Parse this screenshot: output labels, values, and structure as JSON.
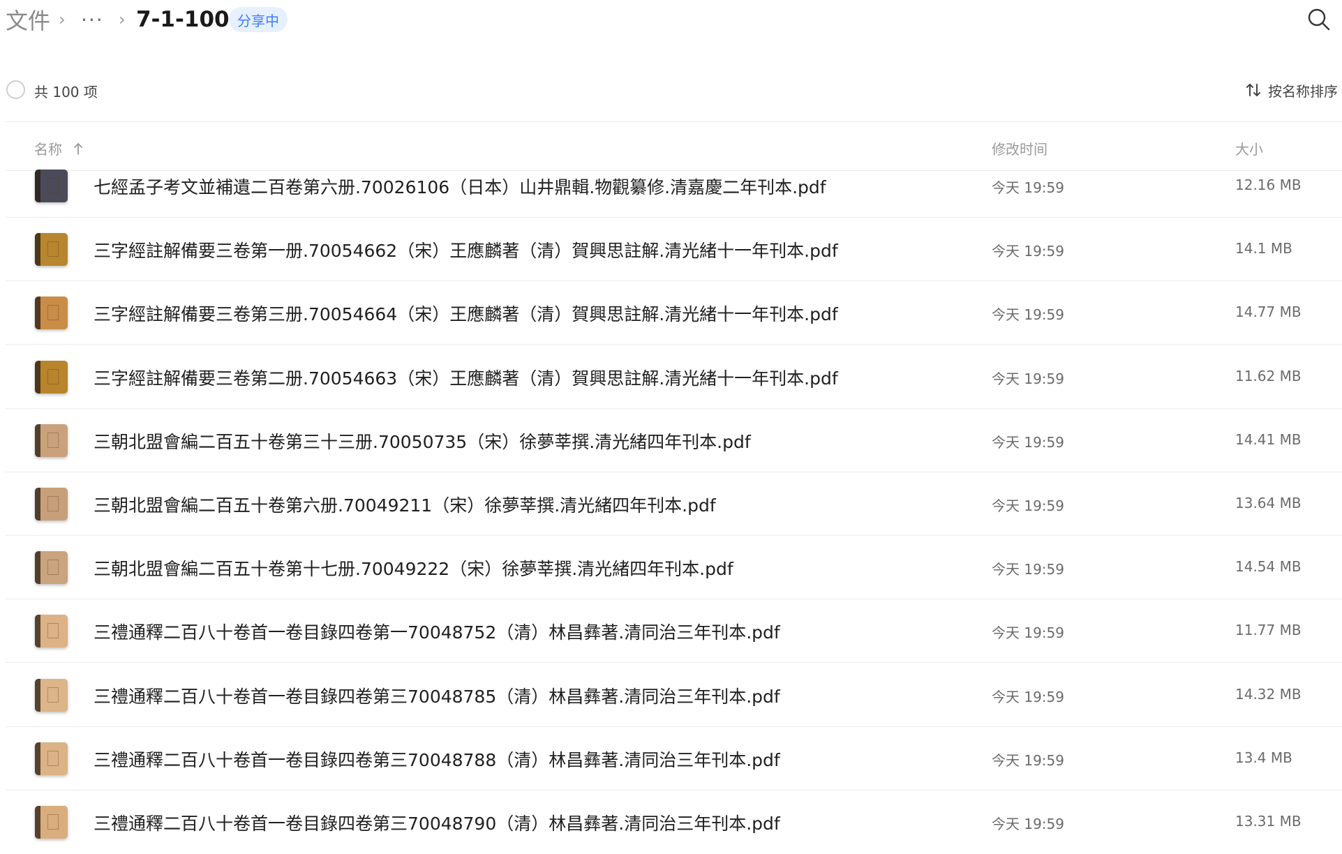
{
  "breadcrumb": {
    "root": "文件",
    "separator": "›",
    "ellipsis": "···",
    "current": "7-1-100",
    "badge": "分享中"
  },
  "toolbar": {
    "item_count": "共 100 项",
    "sort_label": "按名称排序"
  },
  "columns": {
    "name": "名称",
    "modified": "修改时间",
    "size": "大小"
  },
  "colors": {
    "badge_bg": "#e6f0ff",
    "badge_text": "#3d7bff"
  },
  "files": [
    {
      "name": "七經孟子考文並補遺二百卷第六册.70026106（日本）山井鼎輯.物觀纂修.清嘉慶二年刊本.pdf",
      "modified": "今天 19:59",
      "size": "12.16 MB",
      "thumb_color": "#4a4a58"
    },
    {
      "name": "三字經註解備要三卷第一册.70054662（宋）王應麟著（清）賀興思註解.清光緒十一年刊本.pdf",
      "modified": "今天 19:59",
      "size": "14.1 MB",
      "thumb_color": "#b8862e"
    },
    {
      "name": "三字經註解備要三卷第三册.70054664（宋）王應麟著（清）賀興思註解.清光緒十一年刊本.pdf",
      "modified": "今天 19:59",
      "size": "14.77 MB",
      "thumb_color": "#c98d47"
    },
    {
      "name": "三字經註解備要三卷第二册.70054663（宋）王應麟著（清）賀興思註解.清光緒十一年刊本.pdf",
      "modified": "今天 19:59",
      "size": "11.62 MB",
      "thumb_color": "#b8842c"
    },
    {
      "name": "三朝北盟會編二百五十卷第三十三册.70050735（宋）徐夢莘撰.清光緒四年刊本.pdf",
      "modified": "今天 19:59",
      "size": "14.41 MB",
      "thumb_color": "#c9a27c"
    },
    {
      "name": "三朝北盟會編二百五十卷第六册.70049211（宋）徐夢莘撰.清光緒四年刊本.pdf",
      "modified": "今天 19:59",
      "size": "13.64 MB",
      "thumb_color": "#c7a07a"
    },
    {
      "name": "三朝北盟會編二百五十卷第十七册.70049222（宋）徐夢莘撰.清光緒四年刊本.pdf",
      "modified": "今天 19:59",
      "size": "14.54 MB",
      "thumb_color": "#c9a47e"
    },
    {
      "name": "三禮通釋二百八十卷首一卷目錄四卷第一70048752（清）林昌彝著.清同治三年刊本.pdf",
      "modified": "今天 19:59",
      "size": "11.77 MB",
      "thumb_color": "#dcb286"
    },
    {
      "name": "三禮通釋二百八十卷首一卷目錄四卷第三70048785（清）林昌彝著.清同治三年刊本.pdf",
      "modified": "今天 19:59",
      "size": "14.32 MB",
      "thumb_color": "#dcb58a"
    },
    {
      "name": "三禮通釋二百八十卷首一卷目錄四卷第三70048788（清）林昌彝著.清同治三年刊本.pdf",
      "modified": "今天 19:59",
      "size": "13.4 MB",
      "thumb_color": "#dcb386"
    },
    {
      "name": "三禮通釋二百八十卷首一卷目錄四卷第三70048790（清）林昌彝著.清同治三年刊本.pdf",
      "modified": "今天 19:59",
      "size": "13.31 MB",
      "thumb_color": "#d9ad7e"
    }
  ]
}
